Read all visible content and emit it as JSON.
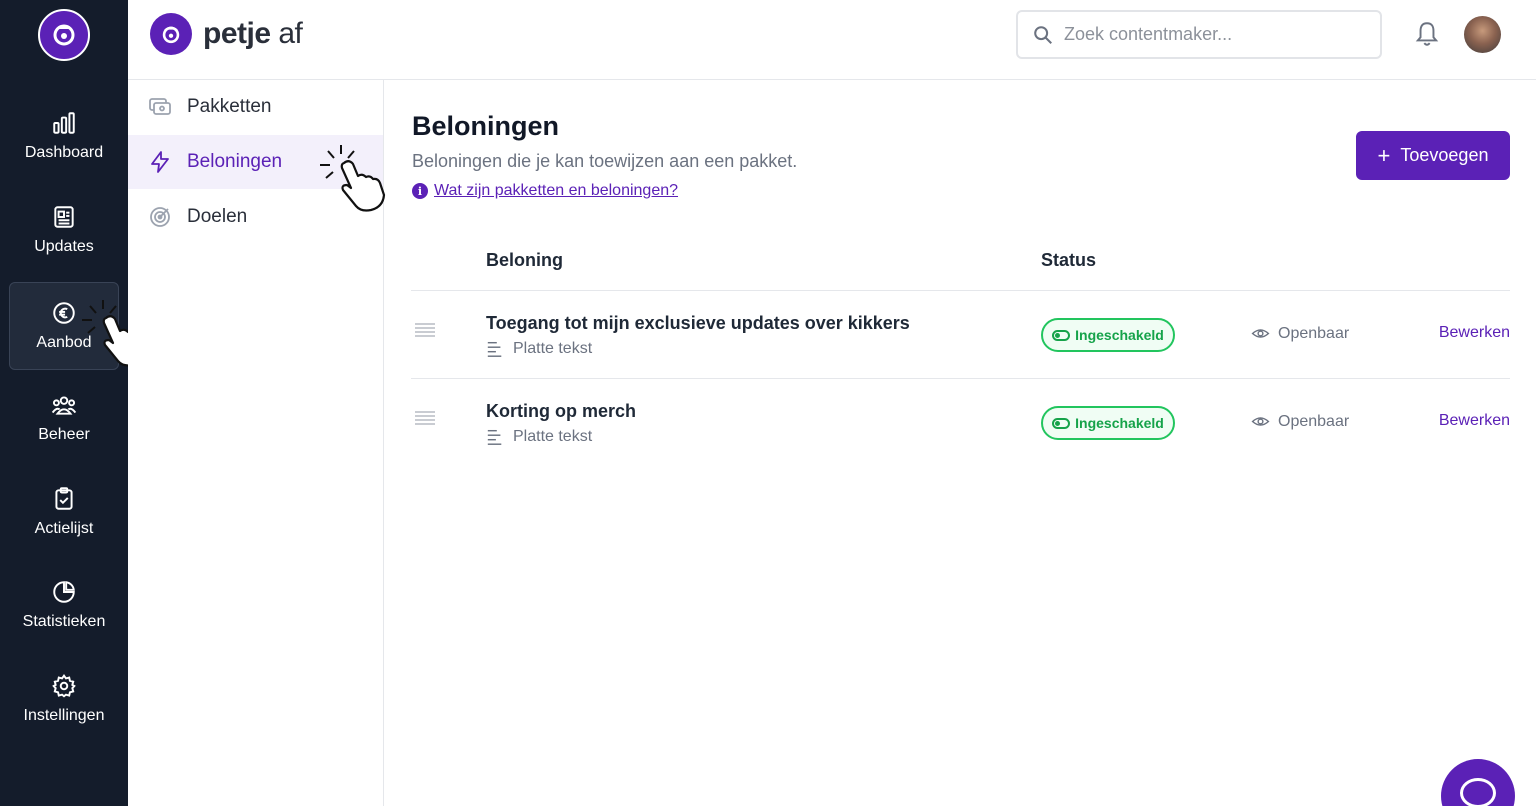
{
  "brand": {
    "name_bold": "petje",
    "name_light": "af"
  },
  "rail": {
    "items": [
      {
        "label": "Dashboard",
        "icon": "bar-chart-icon"
      },
      {
        "label": "Updates",
        "icon": "newspaper-icon"
      },
      {
        "label": "Aanbod",
        "icon": "euro-icon",
        "active": true
      },
      {
        "label": "Beheer",
        "icon": "users-icon"
      },
      {
        "label": "Actielijst",
        "icon": "clipboard-check-icon"
      },
      {
        "label": "Statistieken",
        "icon": "pie-chart-icon"
      },
      {
        "label": "Instellingen",
        "icon": "gear-icon"
      }
    ]
  },
  "header": {
    "search_placeholder": "Zoek contentmaker..."
  },
  "subnav": {
    "items": [
      {
        "label": "Pakketten",
        "icon": "package-icon"
      },
      {
        "label": "Beloningen",
        "icon": "lightning-icon",
        "active": true
      },
      {
        "label": "Doelen",
        "icon": "target-icon"
      }
    ]
  },
  "main": {
    "title": "Beloningen",
    "subtitle": "Beloningen die je kan toewijzen aan een pakket.",
    "help_link": "Wat zijn pakketten en beloningen?",
    "add_button": "Toevoegen",
    "columns": {
      "reward": "Beloning",
      "status": "Status"
    },
    "rows": [
      {
        "title": "Toegang tot mijn exclusieve updates over kikkers",
        "type": "Platte tekst",
        "status": "Ingeschakeld",
        "visibility": "Openbaar",
        "action": "Bewerken"
      },
      {
        "title": "Korting op merch",
        "type": "Platte tekst",
        "status": "Ingeschakeld",
        "visibility": "Openbaar",
        "action": "Bewerken"
      }
    ]
  },
  "colors": {
    "accent": "#5b21b6",
    "rail_bg": "#141c2b",
    "status_green": "#16a34a"
  }
}
